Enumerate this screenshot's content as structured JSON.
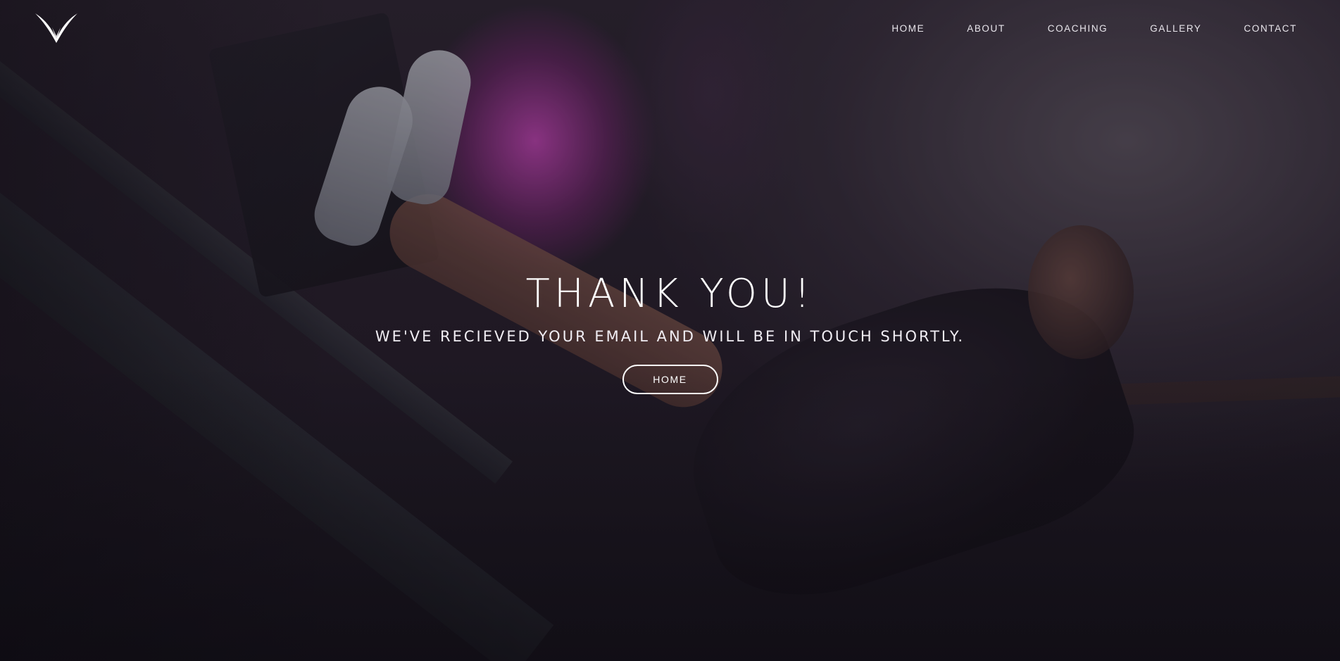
{
  "header": {
    "logo_icon": "v-wing-logo-icon",
    "nav": [
      {
        "label": "HOME"
      },
      {
        "label": "ABOUT"
      },
      {
        "label": "COACHING"
      },
      {
        "label": "GALLERY"
      },
      {
        "label": "CONTACT"
      }
    ]
  },
  "hero": {
    "title": "THANK YOU!",
    "subtitle": "WE'VE RECIEVED YOUR EMAIL AND WILL BE IN TOUCH SHORTLY.",
    "button_label": "HOME"
  },
  "colors": {
    "text": "#ffffff",
    "accent_glow": "#cd46be",
    "background": "#1c1820"
  }
}
